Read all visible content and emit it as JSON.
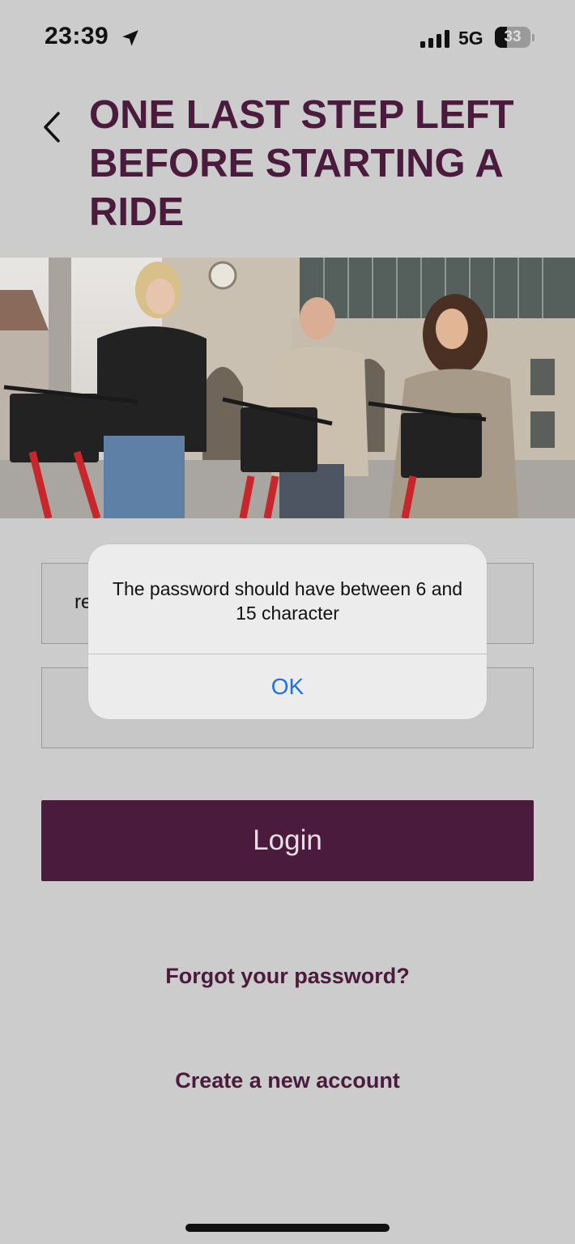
{
  "status_bar": {
    "time": "23:39",
    "network": "5G",
    "battery_level": 33,
    "battery_label": "33",
    "icons": [
      "location-arrow-icon",
      "signal-bars-icon",
      "battery-icon"
    ]
  },
  "header": {
    "back_icon": "chevron-left-icon",
    "title": "ONE LAST STEP LEFT BEFORE STARTING A RIDE"
  },
  "form": {
    "field1_value": "re",
    "field2_value": "",
    "login_label": "Login",
    "forgot_password_label": "Forgot your password?",
    "create_account_label": "Create a new account"
  },
  "alert": {
    "message": "The password should have between 6 and 15 character",
    "ok_label": "OK"
  },
  "colors": {
    "brand": "#4a1b3c",
    "background": "#cccccc",
    "link_blue": "#1a73e8"
  }
}
